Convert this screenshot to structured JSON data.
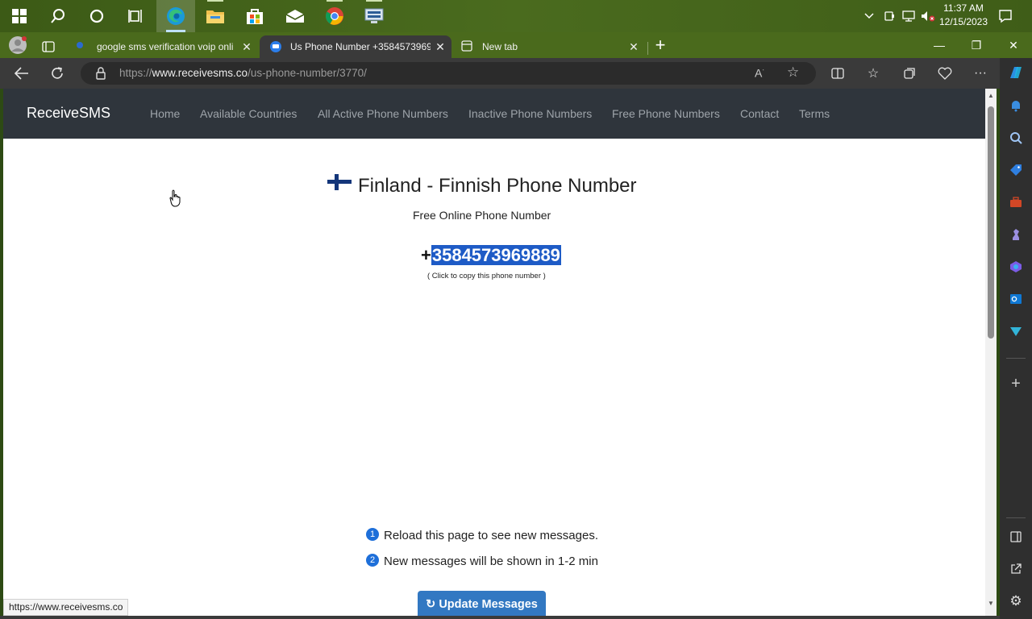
{
  "taskbar": {
    "icons": [
      "windows-start-icon",
      "search-icon",
      "cortana-icon",
      "task-view-icon",
      "edge-icon",
      "file-explorer-icon",
      "store-icon",
      "mail-icon",
      "chrome-icon",
      "network-app-icon"
    ],
    "clock_time": "11:37 AM",
    "clock_date": "12/15/2023"
  },
  "browser": {
    "tabs": [
      {
        "title": "google sms verification voip onli",
        "active": false
      },
      {
        "title": "Us Phone Number +3584573969",
        "active": true
      },
      {
        "title": "New tab",
        "active": false
      }
    ],
    "url_prefix": "https://",
    "url_host": "www.receivesms.co",
    "url_path": "/us-phone-number/3770/"
  },
  "site": {
    "brand": "ReceiveSMS",
    "nav": [
      "Home",
      "Available Countries",
      "All Active Phone Numbers",
      "Inactive Phone Numbers",
      "Free Phone Numbers",
      "Contact",
      "Terms"
    ],
    "heading": "Finland - Finnish Phone Number",
    "subheading": "Free Online Phone Number",
    "phone_plus": "+",
    "phone_number": "3584573969889",
    "copy_hint": "( Click to copy this phone number )",
    "info": [
      {
        "num": "1",
        "text": "Reload this page to see new messages."
      },
      {
        "num": "2",
        "text": "New messages will be shown in 1-2 min"
      }
    ],
    "update_button": "Update Messages",
    "update_icon": "↻"
  },
  "status_bar_url": "https://www.receivesms.co",
  "colors": {
    "accent": "#3278c2",
    "selection": "#1e5bc6",
    "nav_bg": "#2f353c"
  }
}
